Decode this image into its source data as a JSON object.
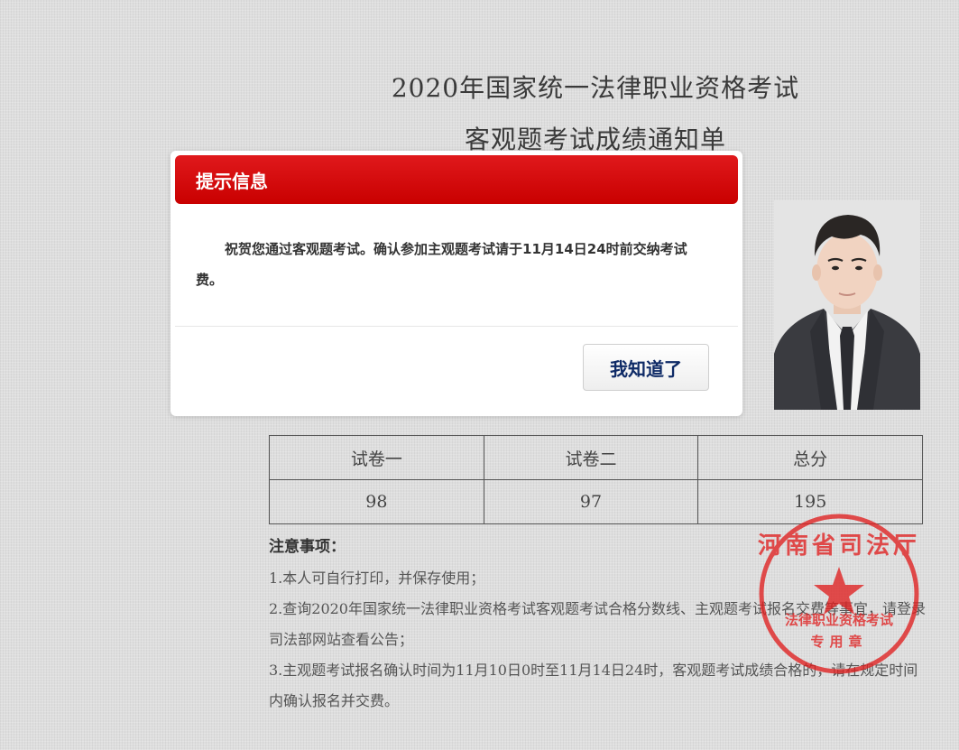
{
  "document": {
    "title_line1": "2020年国家统一法律职业资格考试",
    "title_line2": "客观题考试成绩通知单"
  },
  "score_table": {
    "headers": [
      "试卷一",
      "试卷二",
      "总分"
    ],
    "values": [
      "98",
      "97",
      "195"
    ]
  },
  "notice": {
    "title": "注意事项：",
    "items": [
      "1.本人可自行打印，并保存使用；",
      "2.查询2020年国家统一法律职业资格考试客观题考试合格分数线、主观题考试报名交费等事宜，请登录司法部网站查看公告；",
      "3.主观题考试报名确认时间为11月10日0时至11月14日24时，客观题考试成绩合格的，请在规定时间内确认报名并交费。"
    ]
  },
  "seal": {
    "arc_text": "河南省司法厅",
    "org_text": "法律职业资格考试",
    "use_text": "专用章"
  },
  "modal": {
    "header": "提示信息",
    "message": "祝贺您通过客观题考试。确认参加主观题考试请于11月14日24时前交纳考试费。",
    "button_label": "我知道了"
  },
  "colors": {
    "modal_header": "#d10a0c",
    "button_text": "#0e2a66",
    "seal": "#e02020",
    "page_bg": "#dedede"
  }
}
